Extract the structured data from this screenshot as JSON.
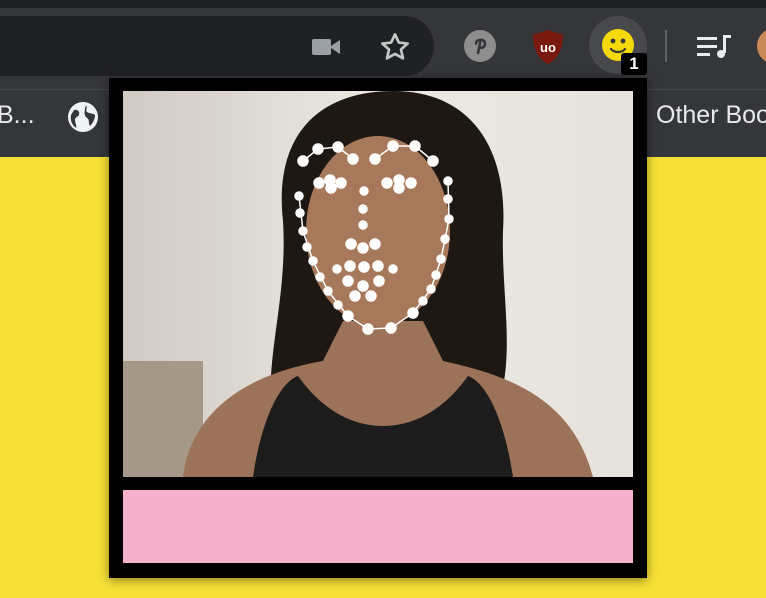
{
  "toolbar": {
    "extensions": [
      {
        "name": "pinterest",
        "icon": "pinterest-icon"
      },
      {
        "name": "ublock-origin",
        "icon": "ublock-icon",
        "label": "uo"
      },
      {
        "name": "face-tracker",
        "icon": "smiley-icon",
        "badge": "1"
      }
    ]
  },
  "bookmarks": {
    "left_item": "B...",
    "other_bookmarks": "Other Boo"
  },
  "popup": {
    "accent": "#f4b1cc",
    "background": "#000000"
  },
  "colors": {
    "page_background": "#f7e135",
    "toolbar": "#35363a",
    "omnibox": "#202124"
  }
}
